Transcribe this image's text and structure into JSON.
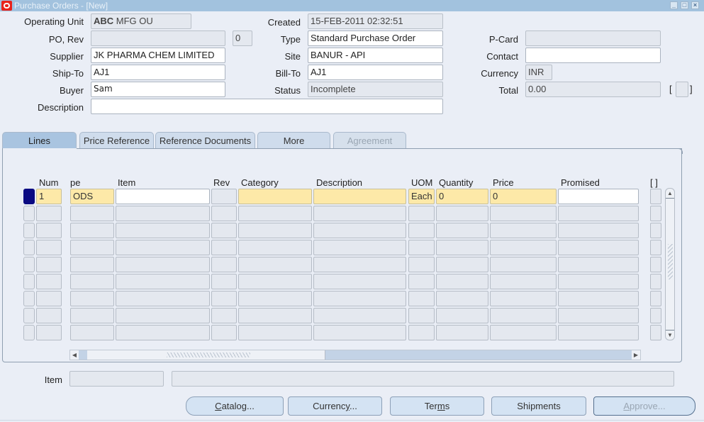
{
  "window": {
    "title": "Purchase Orders - [New]",
    "controls": [
      "minimize",
      "maximize",
      "close"
    ]
  },
  "header": {
    "operating_unit": {
      "label": "Operating Unit",
      "value_bold": "ABC",
      "value_rest": " MFG OU"
    },
    "po_rev": {
      "label": "PO, Rev",
      "po_value": "",
      "rev_value": "0"
    },
    "supplier": {
      "label": "Supplier",
      "value": "JK PHARMA CHEM LIMITED"
    },
    "ship_to": {
      "label": "Ship-To",
      "value": "AJ1"
    },
    "buyer": {
      "label": "Buyer",
      "value": "Sam"
    },
    "description": {
      "label": "Description",
      "value": ""
    },
    "created": {
      "label": "Created",
      "value": "15-FEB-2011 02:32:51"
    },
    "type": {
      "label": "Type",
      "value": "Standard Purchase Order"
    },
    "site": {
      "label": "Site",
      "value": "BANUR - API"
    },
    "bill_to": {
      "label": "Bill-To",
      "value": "AJ1"
    },
    "status": {
      "label": "Status",
      "value": "Incomplete"
    },
    "p_card": {
      "label": "P-Card",
      "value": ""
    },
    "contact": {
      "label": "Contact",
      "value": ""
    },
    "currency": {
      "label": "Currency",
      "value": "INR"
    },
    "total": {
      "label": "Total",
      "value": "0.00"
    },
    "dff_bracket": "[ ]"
  },
  "tabs": [
    {
      "label": "Lines",
      "state": "active"
    },
    {
      "label": "Price Reference",
      "state": "normal"
    },
    {
      "label": "Reference Documents",
      "state": "normal"
    },
    {
      "label": "More",
      "state": "normal"
    },
    {
      "label": "Agreement",
      "state": "disabled"
    }
  ],
  "lines": {
    "columns": [
      "Num",
      "pe",
      "Item",
      "Rev",
      "Category",
      "Description",
      "UOM",
      "Quantity",
      "Price",
      "Promised",
      "[ ]"
    ],
    "rows": [
      {
        "num": "1",
        "type": "ODS",
        "item": "",
        "rev": "",
        "category": "",
        "description": "",
        "uom": "Each",
        "quantity": "0",
        "price": "0",
        "promised": ""
      },
      {
        "num": "",
        "type": "",
        "item": "",
        "rev": "",
        "category": "",
        "description": "",
        "uom": "",
        "quantity": "",
        "price": "",
        "promised": ""
      },
      {
        "num": "",
        "type": "",
        "item": "",
        "rev": "",
        "category": "",
        "description": "",
        "uom": "",
        "quantity": "",
        "price": "",
        "promised": ""
      },
      {
        "num": "",
        "type": "",
        "item": "",
        "rev": "",
        "category": "",
        "description": "",
        "uom": "",
        "quantity": "",
        "price": "",
        "promised": ""
      },
      {
        "num": "",
        "type": "",
        "item": "",
        "rev": "",
        "category": "",
        "description": "",
        "uom": "",
        "quantity": "",
        "price": "",
        "promised": ""
      },
      {
        "num": "",
        "type": "",
        "item": "",
        "rev": "",
        "category": "",
        "description": "",
        "uom": "",
        "quantity": "",
        "price": "",
        "promised": ""
      },
      {
        "num": "",
        "type": "",
        "item": "",
        "rev": "",
        "category": "",
        "description": "",
        "uom": "",
        "quantity": "",
        "price": "",
        "promised": ""
      },
      {
        "num": "",
        "type": "",
        "item": "",
        "rev": "",
        "category": "",
        "description": "",
        "uom": "",
        "quantity": "",
        "price": "",
        "promised": ""
      },
      {
        "num": "",
        "type": "",
        "item": "",
        "rev": "",
        "category": "",
        "description": "",
        "uom": "",
        "quantity": "",
        "price": "",
        "promised": ""
      }
    ]
  },
  "footer": {
    "item_label": "Item",
    "item_code": "",
    "item_description": ""
  },
  "buttons": [
    {
      "label": "Catalog...",
      "mnemonic": "C",
      "state": "enabled"
    },
    {
      "label": "Currency...",
      "mnemonic": "y",
      "state": "enabled"
    },
    {
      "label": "Terms",
      "mnemonic": "m",
      "state": "enabled"
    },
    {
      "label": "Shipments",
      "mnemonic": "",
      "state": "enabled"
    },
    {
      "label": "Approve...",
      "mnemonic": "A",
      "state": "disabled"
    }
  ],
  "colors": {
    "titlebar": "#a2c2de",
    "background": "#eaeef6",
    "required_field": "#fde9a8",
    "current_record": "#0a0a82",
    "oracle_logo": "#e8231b"
  }
}
